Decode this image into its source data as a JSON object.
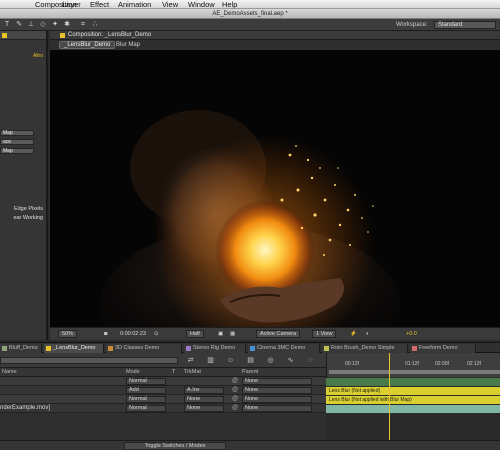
{
  "menu": {
    "items": [
      "Composition",
      "Layer",
      "Effect",
      "Animation",
      "View",
      "Window",
      "Help"
    ]
  },
  "window": {
    "title": "AE_DemoAssets_final.aep *"
  },
  "toolbar": {
    "workspace_label": "Workspace:",
    "workspace_value": "Standard"
  },
  "left_panel": {
    "top_label": "Aliro",
    "dropdowns": [
      "Map",
      "ace",
      "Map"
    ],
    "option_1": "Edge Pixels",
    "option_2": "ear Working"
  },
  "composition_panel": {
    "tab_label": "Composition: _LensBlur_Demo",
    "sub_tabs": [
      "_LensBlur_Demo",
      "Blur Map"
    ]
  },
  "viewer_controls": {
    "zoom": "50%",
    "timecode": "0:00:02:23",
    "resolution": "Half",
    "camera": "Active Camera",
    "view": "1 View",
    "exposure": "+0.0"
  },
  "timeline": {
    "tabs": [
      {
        "label": "Bluff_Demo",
        "color": "#8fa37a"
      },
      {
        "label": "_LensBlur_Demo",
        "color": "#e8c326",
        "active": true
      },
      {
        "label": "3D Classes Demo",
        "color": "#c58a3a"
      },
      {
        "label": "Stereo Rig Demo",
        "color": "#9a7bc4"
      },
      {
        "label": "Cinema 3MC Demo",
        "color": "#4a8fd0"
      },
      {
        "label": "Roto Brush_Demo Simple",
        "color": "#c0c050"
      },
      {
        "label": "Freeform Demo",
        "color": "#d06a6a"
      }
    ],
    "columns": {
      "mode": "Mode",
      "t": "T",
      "trkmat": "TrkMat",
      "parent": "Parent",
      "name": "Name"
    },
    "layers": [
      {
        "name": "",
        "mode": "Normal",
        "trkmat": "",
        "parent": "None"
      },
      {
        "name": "",
        "mode": "Add",
        "trkmat": "A.Inv",
        "parent": "None"
      },
      {
        "name": "",
        "mode": "Normal",
        "trkmat": "None",
        "parent": "None"
      },
      {
        "name": "nderExample.mov]",
        "mode": "Normal",
        "trkmat": "None",
        "parent": "None"
      }
    ],
    "tracks": [
      {
        "label": "",
        "color": "#4a7a4a"
      },
      {
        "label": "Lens Blur (Not applied)",
        "color": "#d9cf2e"
      },
      {
        "label": "Lens Blur (Not applied with Blur Map)",
        "color": "#d9cf2e"
      },
      {
        "label": "",
        "color": "#7fb6a4"
      }
    ],
    "ruler_ticks": [
      "00:12f",
      "01:12f",
      "02:00f",
      "02:12f"
    ],
    "toggle_label": "Toggle Switches / Modes"
  },
  "colors": {
    "accent": "#e8c326",
    "panel_bg": "#353535",
    "viewer_bg": "#050505"
  }
}
